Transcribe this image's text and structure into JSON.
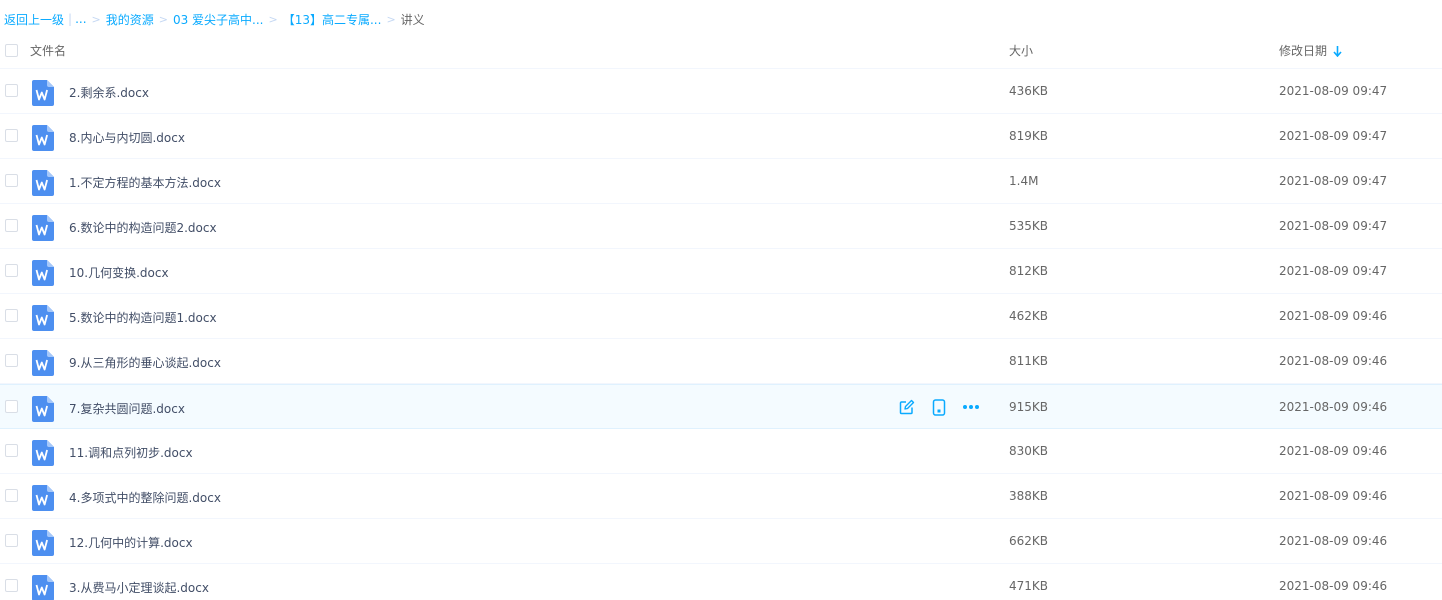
{
  "breadcrumb": {
    "back": "返回上一级",
    "ellipsis": "...",
    "items": [
      "我的资源",
      "03 爱尖子高中...",
      "【13】高二专属..."
    ],
    "current": "讲义"
  },
  "header": {
    "name": "文件名",
    "size": "大小",
    "date": "修改日期"
  },
  "files": [
    {
      "name": "2.剩余系.docx",
      "size": "436KB",
      "date": "2021-08-09 09:47"
    },
    {
      "name": "8.内心与内切圆.docx",
      "size": "819KB",
      "date": "2021-08-09 09:47"
    },
    {
      "name": "1.不定方程的基本方法.docx",
      "size": "1.4M",
      "date": "2021-08-09 09:47"
    },
    {
      "name": "6.数论中的构造问题2.docx",
      "size": "535KB",
      "date": "2021-08-09 09:47"
    },
    {
      "name": "10.几何变换.docx",
      "size": "812KB",
      "date": "2021-08-09 09:47"
    },
    {
      "name": "5.数论中的构造问题1.docx",
      "size": "462KB",
      "date": "2021-08-09 09:46"
    },
    {
      "name": "9.从三角形的垂心谈起.docx",
      "size": "811KB",
      "date": "2021-08-09 09:46"
    },
    {
      "name": "7.复杂共圆问题.docx",
      "size": "915KB",
      "date": "2021-08-09 09:46"
    },
    {
      "name": "11.调和点列初步.docx",
      "size": "830KB",
      "date": "2021-08-09 09:46"
    },
    {
      "name": "4.多项式中的整除问题.docx",
      "size": "388KB",
      "date": "2021-08-09 09:46"
    },
    {
      "name": "12.几何中的计算.docx",
      "size": "662KB",
      "date": "2021-08-09 09:46"
    },
    {
      "name": "3.从费马小定理谈起.docx",
      "size": "471KB",
      "date": "2021-08-09 09:46"
    }
  ],
  "hovered_row": 7,
  "icons": {
    "file": "word-doc-icon",
    "edit": "edit-icon",
    "mobile": "phone-icon",
    "more": "more-dots-icon",
    "sort": "arrow-down-icon"
  },
  "colors": {
    "link": "#09aaff",
    "word_icon": "#4d8ff0",
    "hover_bg": "#f4fbff"
  }
}
